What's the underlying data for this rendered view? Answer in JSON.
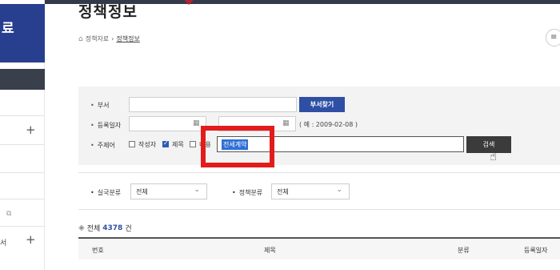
{
  "page": {
    "title": "정책정보",
    "breadcrumb": [
      "정책자료",
      "정책정보"
    ]
  },
  "sidebar": {
    "header_text": "료",
    "items": [
      "",
      "",
      "",
      "서"
    ]
  },
  "search": {
    "dept_label": "부서",
    "dept_button": "부서찾기",
    "date_label": "등록일자",
    "date_hint": "( 예 : 2009-02-08 )",
    "keyword_label": "주제어",
    "options": [
      {
        "label": "작성자",
        "checked": false
      },
      {
        "label": "제목",
        "checked": true
      },
      {
        "label": "내용",
        "checked": false
      }
    ],
    "keyword_value": "전세계약",
    "search_button": "검색"
  },
  "filters": {
    "dept_label": "실국분류",
    "dept_value": "전체",
    "policy_label": "정책분류",
    "policy_value": "전체"
  },
  "results": {
    "total_prefix": "전체",
    "total_count": "4378",
    "total_suffix": "건",
    "columns": [
      "번호",
      "제목",
      "분류",
      "등록일자"
    ]
  },
  "colors": {
    "accent": "#283f8f",
    "button_blue": "#2e4fa3",
    "highlight": "#e41b1b"
  }
}
